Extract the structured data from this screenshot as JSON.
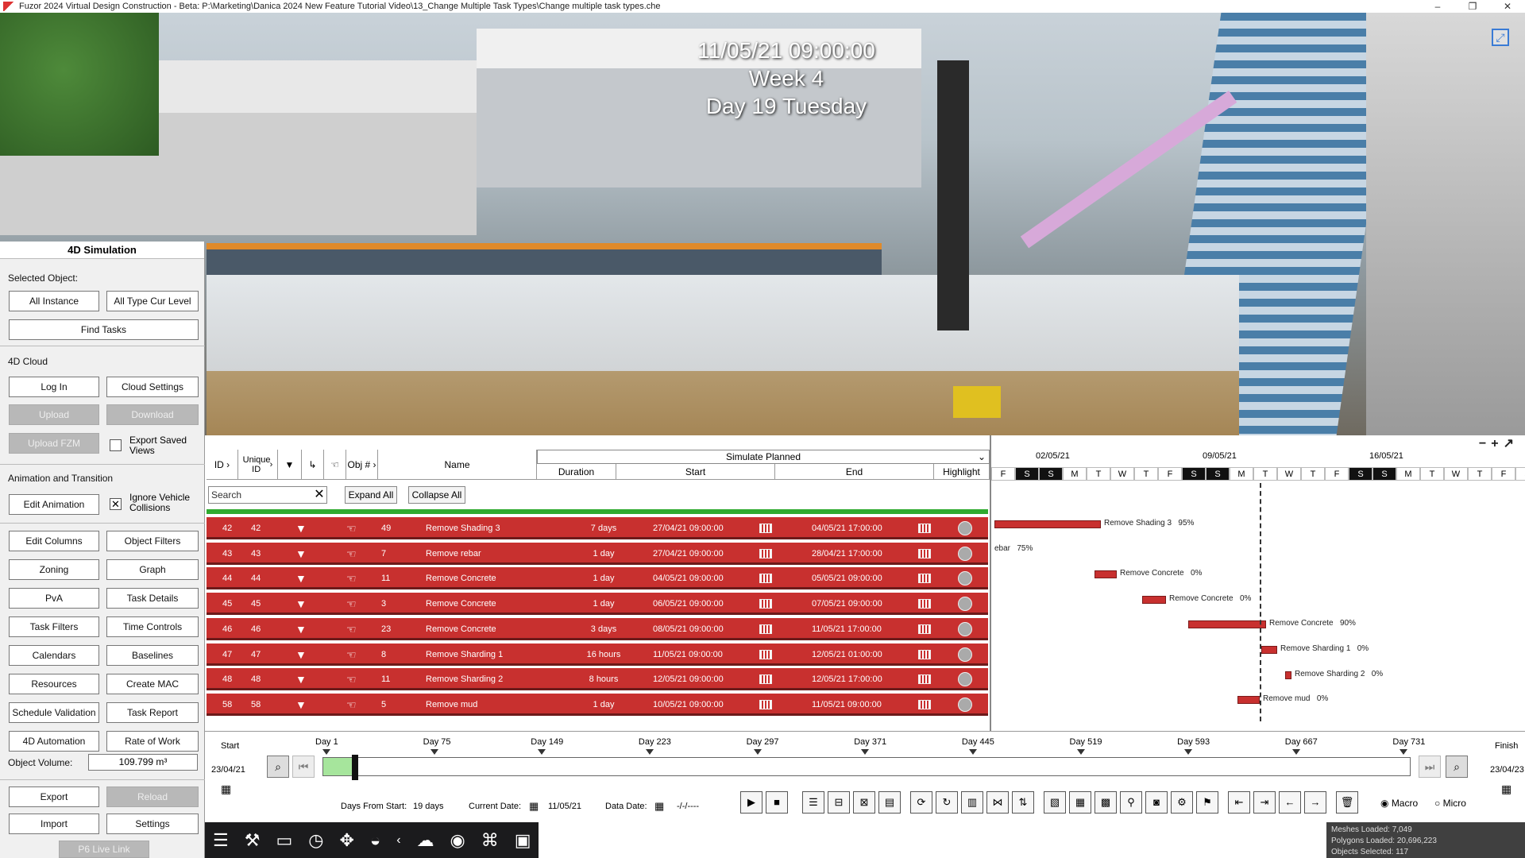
{
  "window": {
    "title": "Fuzor 2024 Virtual Design Construction - Beta: P:\\Marketing\\Danica 2024 New Feature Tutorial Video\\13_Change Multiple Task Types\\Change multiple task types.che",
    "minimize": "–",
    "restore": "❐",
    "close": "✕"
  },
  "viewport": {
    "datetime": "11/05/21 09:00:00",
    "week": "Week 4",
    "day": "Day 19 Tuesday"
  },
  "left_panel": {
    "title": "4D Simulation",
    "selected_object_label": "Selected Object:",
    "all_instance": "All Instance",
    "all_type_cur_level": "All Type Cur Level",
    "find_tasks": "Find Tasks",
    "cloud_label": "4D Cloud",
    "log_in": "Log In",
    "cloud_settings": "Cloud Settings",
    "upload": "Upload",
    "download": "Download",
    "upload_fzm": "Upload FZM",
    "export_saved_views": "Export Saved Views",
    "anim_label": "Animation and Transition",
    "edit_animation": "Edit Animation",
    "ignore_vehicle": "Ignore Vehicle Collisions",
    "edit_columns": "Edit Columns",
    "object_filters": "Object Filters",
    "zoning": "Zoning",
    "graph": "Graph",
    "pva": "PvA",
    "task_details": "Task Details",
    "task_filters": "Task Filters",
    "time_controls": "Time Controls",
    "calendars": "Calendars",
    "baselines": "Baselines",
    "resources": "Resources",
    "create_mac": "Create MAC",
    "schedule_validation": "Schedule Validation",
    "task_report": "Task Report",
    "automation": "4D Automation",
    "rate_of_work": "Rate of Work",
    "object_volume_label": "Object Volume:",
    "object_volume": "109.799 m³",
    "export": "Export",
    "reload": "Reload",
    "import": "Import",
    "settings": "Settings",
    "p6_live_link": "P6 Live Link"
  },
  "grid": {
    "headers": {
      "id": "ID",
      "unique_id": "Unique ID",
      "obj": "Obj #",
      "name": "Name",
      "simulate": "Simulate Planned",
      "duration": "Duration",
      "start": "Start",
      "end": "End",
      "highlight": "Highlight"
    },
    "search_placeholder": "Search",
    "expand_all": "Expand All",
    "collapse_all": "Collapse All",
    "rows": [
      {
        "id": "42",
        "uid": "42",
        "obj": "49",
        "name": "Remove Shading 3",
        "duration": "7 days",
        "start": "27/04/21 09:00:00",
        "end": "04/05/21 17:00:00"
      },
      {
        "id": "43",
        "uid": "43",
        "obj": "7",
        "name": "Remove rebar",
        "duration": "1 day",
        "start": "27/04/21 09:00:00",
        "end": "28/04/21 17:00:00"
      },
      {
        "id": "44",
        "uid": "44",
        "obj": "11",
        "name": "Remove Concrete",
        "duration": "1 day",
        "start": "04/05/21 09:00:00",
        "end": "05/05/21 09:00:00"
      },
      {
        "id": "45",
        "uid": "45",
        "obj": "3",
        "name": "Remove Concrete",
        "duration": "1 day",
        "start": "06/05/21 09:00:00",
        "end": "07/05/21 09:00:00"
      },
      {
        "id": "46",
        "uid": "46",
        "obj": "23",
        "name": "Remove Concrete",
        "duration": "3 days",
        "start": "08/05/21 09:00:00",
        "end": "11/05/21 17:00:00"
      },
      {
        "id": "47",
        "uid": "47",
        "obj": "8",
        "name": "Remove Sharding 1",
        "duration": "16 hours",
        "start": "11/05/21 09:00:00",
        "end": "12/05/21 01:00:00"
      },
      {
        "id": "48",
        "uid": "48",
        "obj": "11",
        "name": "Remove Sharding 2",
        "duration": "8 hours",
        "start": "12/05/21 09:00:00",
        "end": "12/05/21 17:00:00"
      },
      {
        "id": "58",
        "uid": "58",
        "obj": "5",
        "name": "Remove mud",
        "duration": "1 day",
        "start": "10/05/21 09:00:00",
        "end": "11/05/21 09:00:00"
      }
    ]
  },
  "gantt": {
    "dates": [
      "02/05/21",
      "09/05/21",
      "16/05/21"
    ],
    "days": [
      "F",
      "S",
      "S",
      "M",
      "T",
      "W",
      "T",
      "F",
      "S",
      "S",
      "M",
      "T",
      "W",
      "T",
      "F",
      "S",
      "S",
      "M",
      "T",
      "W",
      "T",
      "F",
      "S"
    ],
    "labels": [
      {
        "name": "Remove Shading 3",
        "pct": "95%"
      },
      {
        "name": "ebar",
        "pct": "75%"
      },
      {
        "name": "Remove Concrete",
        "pct": "0%"
      },
      {
        "name": "Remove Concrete",
        "pct": "0%"
      },
      {
        "name": "Remove Concrete",
        "pct": "90%"
      },
      {
        "name": "Remove Sharding 1",
        "pct": "0%"
      },
      {
        "name": "Remove Sharding 2",
        "pct": "0%"
      },
      {
        "name": "Remove mud",
        "pct": "0%"
      }
    ]
  },
  "timeline": {
    "start_label": "Start",
    "finish_label": "Finish",
    "start_date": "23/04/21",
    "finish_date": "23/04/23",
    "ticks": [
      "Day 1",
      "Day 75",
      "Day 149",
      "Day 223",
      "Day 297",
      "Day 371",
      "Day 445",
      "Day 519",
      "Day 593",
      "Day 667",
      "Day 731"
    ],
    "days_from_start_label": "Days From Start:",
    "days_from_start": "19 days",
    "current_date_label": "Current Date:",
    "current_date": "11/05/21",
    "data_date_label": "Data Date:",
    "data_date": "-/-/----",
    "macro": "Macro",
    "micro": "Micro"
  },
  "stats": {
    "meshes": "Meshes Loaded: 7,049",
    "polygons": "Polygons Loaded: 20,696,223",
    "objects": "Objects Selected: 117"
  }
}
